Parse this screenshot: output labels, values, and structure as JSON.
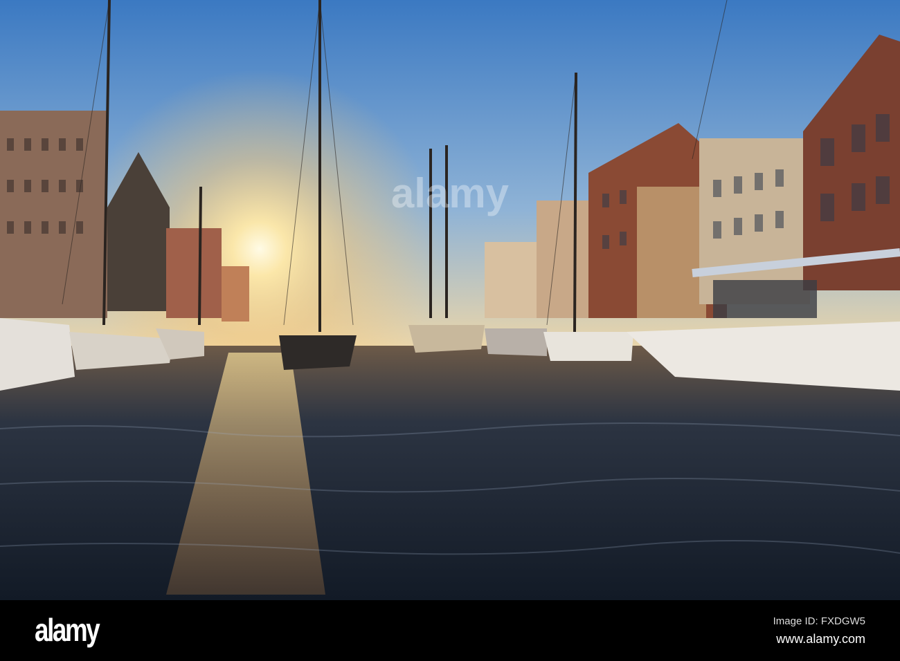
{
  "watermark": {
    "text": "alamy"
  },
  "footer": {
    "logo": "alamy",
    "image_id": "Image ID: FXDGW5",
    "website": "www.alamy.com"
  },
  "colors": {
    "sky_top": "#3a78c0",
    "sun": "#fff4c8",
    "water": "#1e2a3a",
    "footer": "#000000"
  }
}
